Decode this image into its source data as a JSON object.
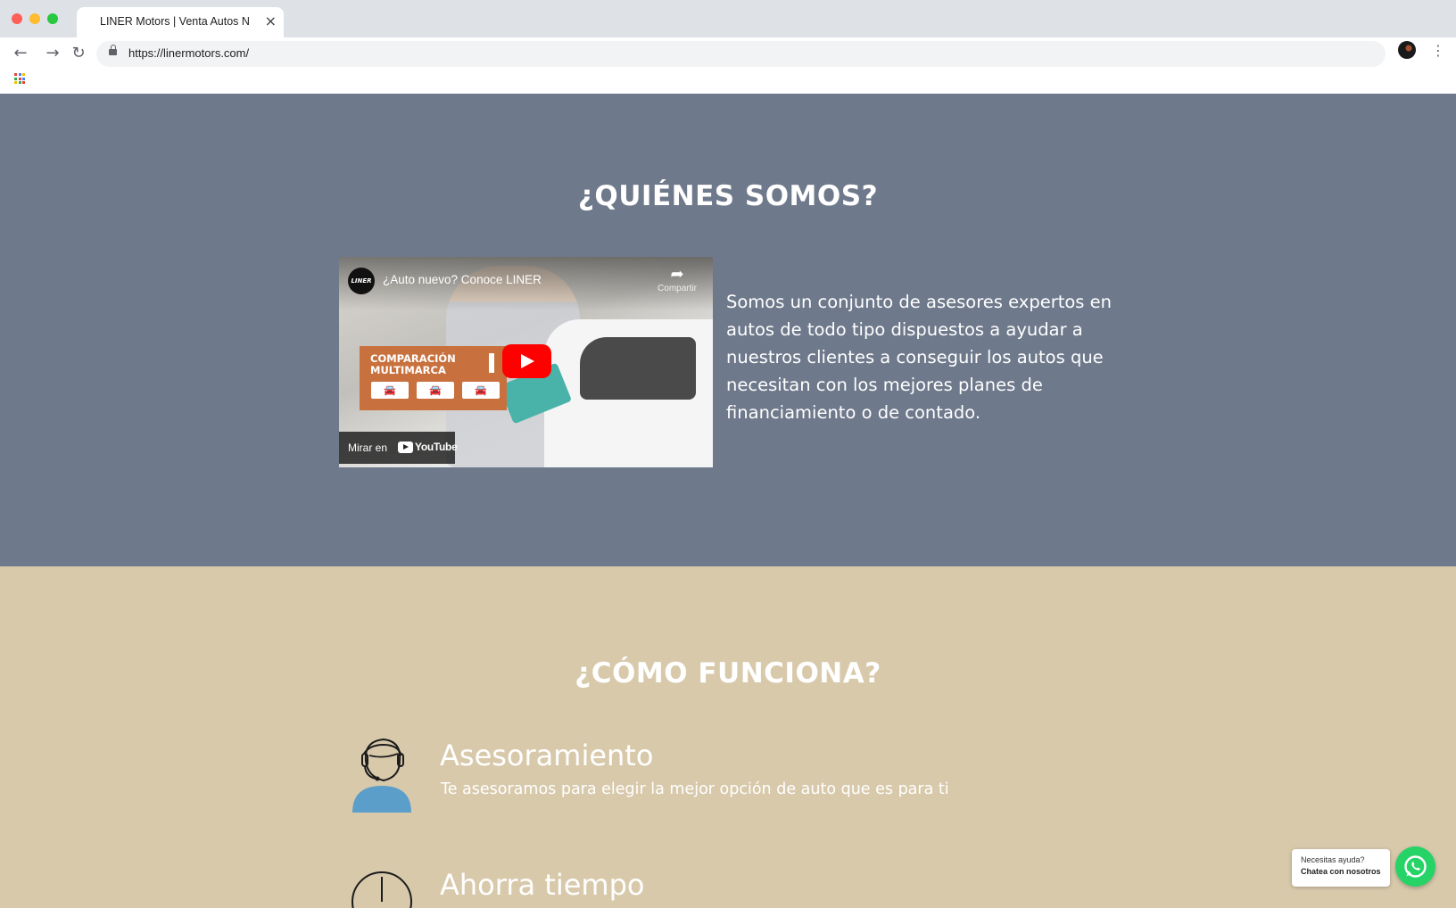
{
  "browser": {
    "tab_title": "LINER Motors | Venta Autos N",
    "tab_close": "×",
    "url": "https://linermotors.com/",
    "nav": {
      "back": "←",
      "forward": "→",
      "reload": "↻"
    },
    "menu": "⋮"
  },
  "about": {
    "title": "¿QUIÉNES SOMOS?",
    "description": "Somos un conjunto de asesores expertos en autos de todo tipo dispuestos a ayudar a nuestros clientes a conseguir los autos que necesitan con los mejores planes de financiamiento o de contado.",
    "video": {
      "channel_logo": "LINER",
      "title": "¿Auto nuevo? Conoce LINER",
      "share_label": "Compartir",
      "promo_text": "COMPARACIÓN\nMULTIMARCA",
      "watch_on": "Mirar en",
      "youtube_word": "YouTube"
    }
  },
  "how": {
    "title": "¿CÓMO FUNCIONA?",
    "steps": [
      {
        "title": "Asesoramiento",
        "description": "Te asesoramos para elegir la mejor opción de auto que es para ti",
        "icon": "advisor-headset-icon"
      },
      {
        "title": "Ahorra tiempo",
        "icon": "clock-icon"
      }
    ]
  },
  "chat_widget": {
    "line1": "Necesitas ayuda?",
    "line2": "Chatea con nosotros",
    "icon": "whatsapp-icon",
    "color": "#25d366"
  },
  "colors": {
    "about_bg": "#6e798b",
    "how_bg": "#d8c9ab",
    "step_icon_accent": "#5b9ec9"
  }
}
